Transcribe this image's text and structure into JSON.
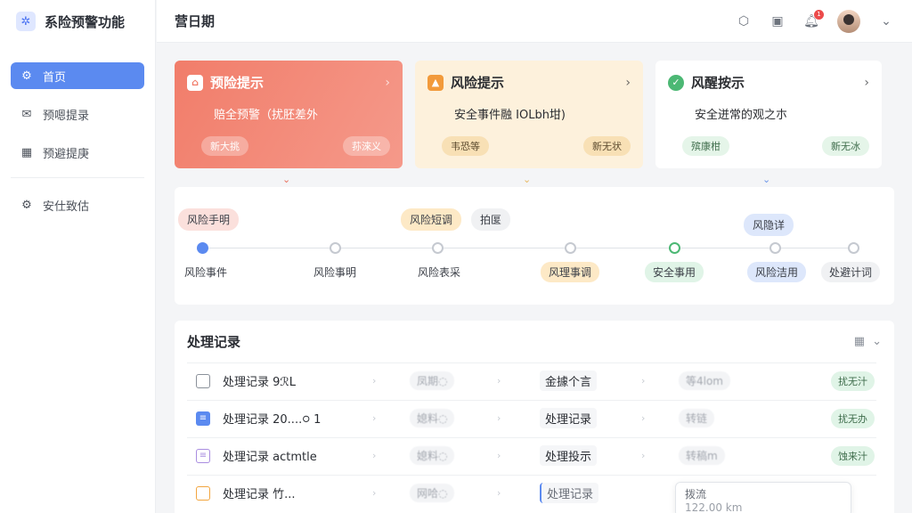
{
  "app": {
    "title": "系险预警功能",
    "logo_icon": "puzzle-icon"
  },
  "sidebar": {
    "items": [
      {
        "label": "首页",
        "icon": "home-gear-icon",
        "active": true
      },
      {
        "label": "预嗯提录",
        "icon": "mail-icon",
        "active": false
      },
      {
        "label": "预避提庚",
        "icon": "calendar-icon",
        "active": false
      },
      {
        "label": "安仕致估",
        "icon": "settings-icon",
        "active": false
      }
    ]
  },
  "header": {
    "title": "营日期",
    "notification_count": "1"
  },
  "cards": [
    {
      "title": "预险提示",
      "text": "赔全预警（扰胚差外",
      "tag_left": "新大挑",
      "tag_right": "荪淶义",
      "color": "#f17d6a"
    },
    {
      "title": "风险提示",
      "text": "安全事件融 IOLbh坩)",
      "tag_left": "韦恐等",
      "tag_right": "新无状",
      "color": "#fdf1dc"
    },
    {
      "title": "风醒按示",
      "text": "安全迸常的观之朩",
      "tag_left": "殡康柑",
      "tag_right": "新无冰",
      "color": "#ffffff"
    }
  ],
  "timeline": {
    "pills": [
      "风险手明",
      "风险短调",
      "拍匽",
      "风隐详"
    ],
    "steps": [
      {
        "label": "风险事件",
        "style": "plain"
      },
      {
        "label": "风险事明",
        "style": "plain"
      },
      {
        "label": "风险表采",
        "style": "plain"
      },
      {
        "label": "风理事调",
        "style": "orange"
      },
      {
        "label": "安全事用",
        "style": "green"
      },
      {
        "label": "风险洁用",
        "style": "blue"
      },
      {
        "label": "处避计词",
        "style": "gray"
      }
    ]
  },
  "records": {
    "title": "处理记录",
    "rows": [
      {
        "name": "处理记录 9ℛL",
        "col2": "凤期◌",
        "type": "金據个言",
        "col4": "等4lom",
        "status": "扰无汁",
        "icon_color": "#8a9099"
      },
      {
        "name": "处理记录 20....᳃ 1",
        "col2": "媳料◌",
        "type": "处理记录",
        "col4": "转链",
        "status": "扰无办",
        "icon_color": "#5b8af0"
      },
      {
        "name": "处理记录 actmtle",
        "col2": "媳料◌",
        "type": "处理投示",
        "col4": "转稿m",
        "status": "蚀来汁",
        "icon_color": "#a98de0"
      },
      {
        "name": "处理记录 竹...",
        "col2": "网哈◌",
        "type": "处理记录",
        "col4": "",
        "status": "",
        "icon_color": "#f2a53f"
      }
    ]
  },
  "popover": {
    "line1": "拨流",
    "line2": "122.00 km"
  }
}
